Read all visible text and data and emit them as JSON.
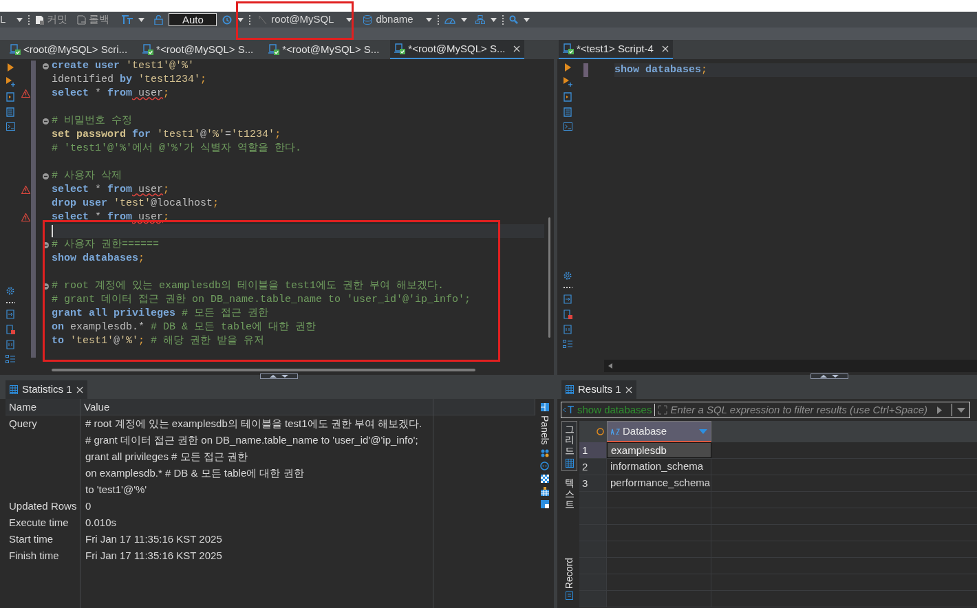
{
  "toolbar": {
    "mode_menu": "L",
    "commit": "커밋",
    "rollback": "롤백",
    "transaction_mode": "Auto",
    "connection": "root@MySQL",
    "database": "dbname"
  },
  "editor_tabs": [
    {
      "label": "<root@MySQL> Scri...",
      "selected": false
    },
    {
      "label": "*<root@MySQL> S...",
      "selected": false
    },
    {
      "label": "*<root@MySQL> S...",
      "selected": false
    },
    {
      "label": "*<root@MySQL> S...",
      "selected": true
    }
  ],
  "editor": {
    "lines": [
      {
        "fold": true,
        "warning": false,
        "current": false,
        "tokens": [
          {
            "kind": "keyword",
            "text": "create"
          },
          {
            "kind": "keyword",
            "text": " user"
          },
          {
            "kind": "string",
            "text": " 'test1'@'%'"
          }
        ]
      },
      {
        "fold": false,
        "warning": false,
        "current": false,
        "tokens": [
          {
            "kind": "plain",
            "text": "identified "
          },
          {
            "kind": "keyword",
            "text": "by"
          },
          {
            "kind": "string",
            "text": " 'test1234'"
          },
          {
            "kind": "punct",
            "text": ";"
          }
        ]
      },
      {
        "fold": false,
        "warning": true,
        "current": false,
        "tokens": [
          {
            "kind": "keyword",
            "text": "select"
          },
          {
            "kind": "plain",
            "text": " * "
          },
          {
            "kind": "keyword",
            "text": "from"
          },
          {
            "kind": "flagged",
            "text": " user"
          },
          {
            "kind": "punct",
            "text": ";"
          }
        ]
      },
      {
        "fold": false,
        "warning": false,
        "current": false
      },
      {
        "fold": true,
        "warning": false,
        "current": false,
        "tokens": [
          {
            "kind": "comment",
            "text": "# 비밀번호 수정"
          }
        ]
      },
      {
        "fold": false,
        "warning": false,
        "current": false,
        "tokens": [
          {
            "kind": "keyword2",
            "text": "set password"
          },
          {
            "kind": "keyword",
            "text": " for"
          },
          {
            "kind": "string",
            "text": " 'test1'"
          },
          {
            "kind": "plain",
            "text": "@"
          },
          {
            "kind": "string",
            "text": "'%'"
          },
          {
            "kind": "plain",
            "text": "="
          },
          {
            "kind": "string",
            "text": "'t1234'"
          },
          {
            "kind": "punct",
            "text": ";"
          }
        ]
      },
      {
        "fold": false,
        "warning": false,
        "current": false,
        "tokens": [
          {
            "kind": "comment",
            "text": "# 'test1'@'%'에서 @'%'가 식별자 역할을 한다."
          }
        ]
      },
      {
        "fold": false,
        "warning": false,
        "current": false
      },
      {
        "fold": true,
        "warning": false,
        "current": false,
        "tokens": [
          {
            "kind": "comment",
            "text": "# 사용자 삭제"
          }
        ]
      },
      {
        "fold": false,
        "warning": true,
        "current": false,
        "tokens": [
          {
            "kind": "keyword",
            "text": "select"
          },
          {
            "kind": "plain",
            "text": " * "
          },
          {
            "kind": "keyword",
            "text": "from"
          },
          {
            "kind": "flagged",
            "text": " user"
          },
          {
            "kind": "punct",
            "text": ";"
          }
        ]
      },
      {
        "fold": false,
        "warning": false,
        "current": false,
        "tokens": [
          {
            "kind": "keyword",
            "text": "drop"
          },
          {
            "kind": "keyword",
            "text": " user"
          },
          {
            "kind": "string",
            "text": " 'test'"
          },
          {
            "kind": "plain",
            "text": "@localhost"
          },
          {
            "kind": "punct",
            "text": ";"
          }
        ]
      },
      {
        "fold": false,
        "warning": true,
        "current": false,
        "tokens": [
          {
            "kind": "keyword",
            "text": "select"
          },
          {
            "kind": "plain",
            "text": " * "
          },
          {
            "kind": "keyword",
            "text": "from"
          },
          {
            "kind": "flagged",
            "text": " user"
          },
          {
            "kind": "punct",
            "text": ";"
          }
        ]
      },
      {
        "fold": false,
        "warning": false,
        "current": true
      },
      {
        "fold": true,
        "warning": false,
        "current": false,
        "tokens": [
          {
            "kind": "comment",
            "text": "# 사용자 권한======"
          }
        ]
      },
      {
        "fold": false,
        "warning": false,
        "current": false,
        "tokens": [
          {
            "kind": "keyword",
            "text": "show"
          },
          {
            "kind": "keyword",
            "text": " databases"
          },
          {
            "kind": "punct",
            "text": ";"
          }
        ]
      },
      {
        "fold": false,
        "warning": false,
        "current": false
      },
      {
        "fold": true,
        "warning": false,
        "current": false,
        "tokens": [
          {
            "kind": "comment",
            "text": "# root 계정에 있는 examplesdb의 테이블을 test1에도 권한 부여 해보겠다."
          }
        ]
      },
      {
        "fold": false,
        "warning": false,
        "current": false,
        "tokens": [
          {
            "kind": "comment",
            "text": "# grant 데이터 접근 권한 on DB_name.table_name to 'user_id'@'ip_info';"
          }
        ]
      },
      {
        "fold": false,
        "warning": false,
        "current": false,
        "tokens": [
          {
            "kind": "keyword",
            "text": "grant all privileges"
          },
          {
            "kind": "comment",
            "text": " # 모든 접근 권한"
          }
        ]
      },
      {
        "fold": false,
        "warning": false,
        "current": false,
        "tokens": [
          {
            "kind": "keyword",
            "text": "on"
          },
          {
            "kind": "plain",
            "text": " examplesdb.* "
          },
          {
            "kind": "comment",
            "text": "# DB & 모든 table에 대한 권한"
          }
        ]
      },
      {
        "fold": false,
        "warning": false,
        "current": false,
        "tokens": [
          {
            "kind": "keyword",
            "text": "to"
          },
          {
            "kind": "string",
            "text": " 'test1'"
          },
          {
            "kind": "plain",
            "text": "@"
          },
          {
            "kind": "string",
            "text": "'%'"
          },
          {
            "kind": "punct",
            "text": ";"
          },
          {
            "kind": "comment",
            "text": " # 해당 권한 받을 유저"
          }
        ]
      }
    ]
  },
  "script_tabs": [
    {
      "label": "*<test1> Script-4",
      "selected": true
    }
  ],
  "script_editor": {
    "lines": [
      {
        "fold": false,
        "warning": false,
        "current": true,
        "tokens": [
          {
            "kind": "keyword",
            "text": "show"
          },
          {
            "kind": "keyword",
            "text": " databases"
          },
          {
            "kind": "punct",
            "text": ";"
          }
        ]
      }
    ]
  },
  "statistics": {
    "tab": "Statistics 1",
    "columns": [
      "Name",
      "Value"
    ],
    "rows": [
      {
        "name": "Query",
        "value": [
          "# root 계정에 있는 examplesdb의 테이블을 test1에도 권한 부여 해보겠다.",
          "# grant 데이터 접근 권한 on DB_name.table_name to 'user_id'@'ip_info';",
          "grant all privileges # 모든 접근 권한",
          "on examplesdb.* # DB & 모든 table에 대한 권한",
          "to 'test1'@'%'"
        ]
      },
      {
        "name": "Updated Rows",
        "value": [
          "0"
        ]
      },
      {
        "name": "Execute time",
        "value": [
          "0.010s"
        ]
      },
      {
        "name": "Start time",
        "value": [
          "Fri Jan 17 11:35:16 KST 2025"
        ]
      },
      {
        "name": "Finish time",
        "value": [
          "Fri Jan 17 11:35:16 KST 2025"
        ]
      }
    ],
    "panels_label": "Panels"
  },
  "results": {
    "tab": "Results 1",
    "filter": {
      "query": "show databases",
      "placeholder": "Enter a SQL expression to filter results (use Ctrl+Space)"
    },
    "views": [
      {
        "label": "그리드",
        "selected": true
      },
      {
        "label": "텍스트",
        "selected": false
      }
    ],
    "record_label": "Record",
    "columns": [
      "Database"
    ],
    "rows": [
      {
        "number": "1",
        "selected": true,
        "values": [
          "examplesdb"
        ]
      },
      {
        "number": "2",
        "selected": false,
        "values": [
          "information_schema"
        ]
      },
      {
        "number": "3",
        "selected": false,
        "values": [
          "performance_schema"
        ]
      }
    ]
  }
}
